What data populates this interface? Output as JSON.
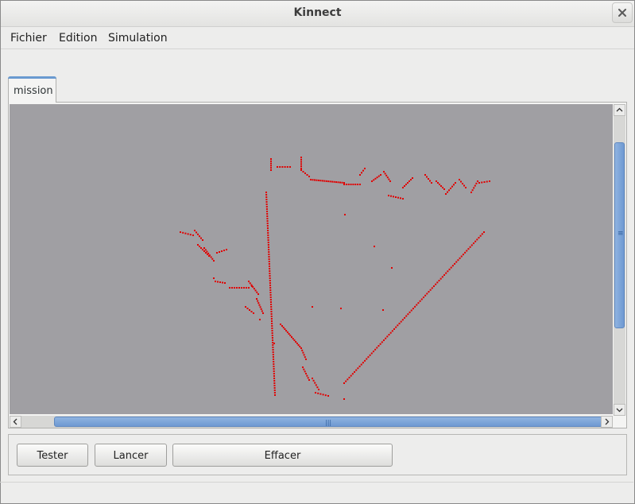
{
  "window": {
    "title": "Kinnect"
  },
  "menu": {
    "items": [
      "Fichier",
      "Edition",
      "Simulation"
    ]
  },
  "tabs": [
    {
      "label": "mission",
      "active": true
    }
  ],
  "canvas": {
    "background": "#a09fa3",
    "point_color": "#e00000"
  },
  "buttons": {
    "tester": "Tester",
    "lancer": "Lancer",
    "effacer": "Effacer"
  },
  "icons": {
    "close": "close-icon",
    "scroll_up": "arrow-up-icon",
    "scroll_down": "arrow-down-icon",
    "scroll_left": "arrow-left-icon",
    "scroll_right": "arrow-right-icon"
  },
  "accent_color": "#6f99d2"
}
